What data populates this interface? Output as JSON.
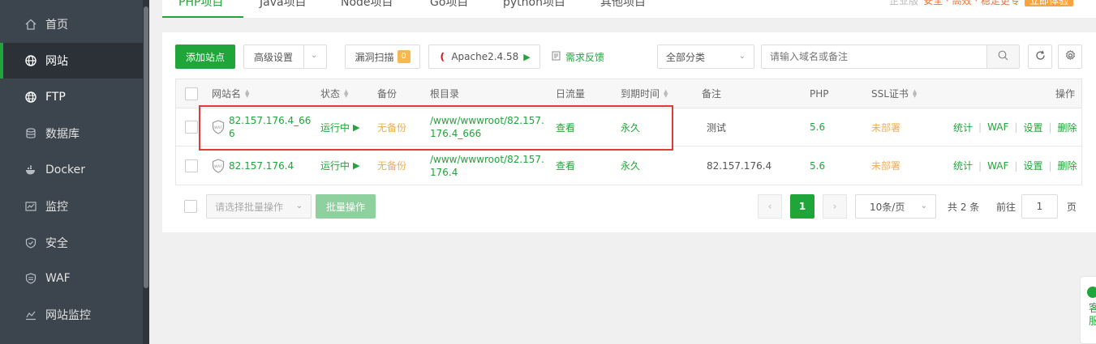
{
  "sidebar": {
    "items": [
      {
        "label": "首页",
        "icon": "home-icon"
      },
      {
        "label": "网站",
        "icon": "globe-icon",
        "active": true
      },
      {
        "label": "FTP",
        "icon": "ftp-globe-icon"
      },
      {
        "label": "数据库",
        "icon": "database-icon"
      },
      {
        "label": "Docker",
        "icon": "docker-icon"
      },
      {
        "label": "监控",
        "icon": "monitor-icon"
      },
      {
        "label": "安全",
        "icon": "shield-icon"
      },
      {
        "label": "WAF",
        "icon": "waf-shield-icon"
      },
      {
        "label": "网站监控",
        "icon": "chart-line-icon"
      }
    ]
  },
  "top_tabs": [
    "PHP项目",
    "Java项目",
    "Node项目",
    "Go项目",
    "python项目",
    "其他项目"
  ],
  "promo": {
    "text1": "企业版",
    "text2": "安全 · 高效 · 稳定更专",
    "button": "立即体验"
  },
  "toolbar": {
    "add_site": "添加站点",
    "advanced": "高级设置",
    "vuln_scan": "漏洞扫描",
    "vuln_count": "0",
    "apache": "Apache2.4.58",
    "feedback": "需求反馈",
    "category": "全部分类",
    "search_placeholder": "请输入域名或备注"
  },
  "table": {
    "headers": {
      "name": "网站名",
      "status": "状态",
      "backup": "备份",
      "root": "根目录",
      "traffic": "日流量",
      "expire": "到期时间",
      "note": "备注",
      "php": "PHP",
      "ssl": "SSL证书",
      "actions": "操作"
    },
    "rows": [
      {
        "name_line1": "82.157.176.4_66",
        "name_line2": "6",
        "status": "运行中",
        "backup": "无备份",
        "root_line1": "/www/wwwroot/82.157.",
        "root_line2": "176.4_666",
        "traffic": "查看",
        "expire": "永久",
        "note": "测试",
        "php": "5.6",
        "ssl": "未部署",
        "act_stats": "统计",
        "act_waf": "WAF",
        "act_settings": "设置",
        "act_delete": "删除"
      },
      {
        "name_line1": "82.157.176.4",
        "name_line2": "",
        "status": "运行中",
        "backup": "无备份",
        "root_line1": "/www/wwwroot/82.157.",
        "root_line2": "176.4",
        "traffic": "查看",
        "expire": "永久",
        "note": "82.157.176.4",
        "php": "5.6",
        "ssl": "未部署",
        "act_stats": "统计",
        "act_waf": "WAF",
        "act_settings": "设置",
        "act_delete": "删除"
      }
    ]
  },
  "footer": {
    "batch_placeholder": "请选择批量操作",
    "batch_button": "批量操作",
    "current_page": "1",
    "page_size": "10条/页",
    "total": "共 2 条",
    "goto_label": "前往",
    "goto_value": "1",
    "page_suffix": "页"
  },
  "float_widget": {
    "text": "客服"
  },
  "colors": {
    "accent": "#20a53a",
    "sidebar_bg": "#3c444d",
    "warning": "#f0ad4e",
    "highlight": "#e03a3a"
  }
}
